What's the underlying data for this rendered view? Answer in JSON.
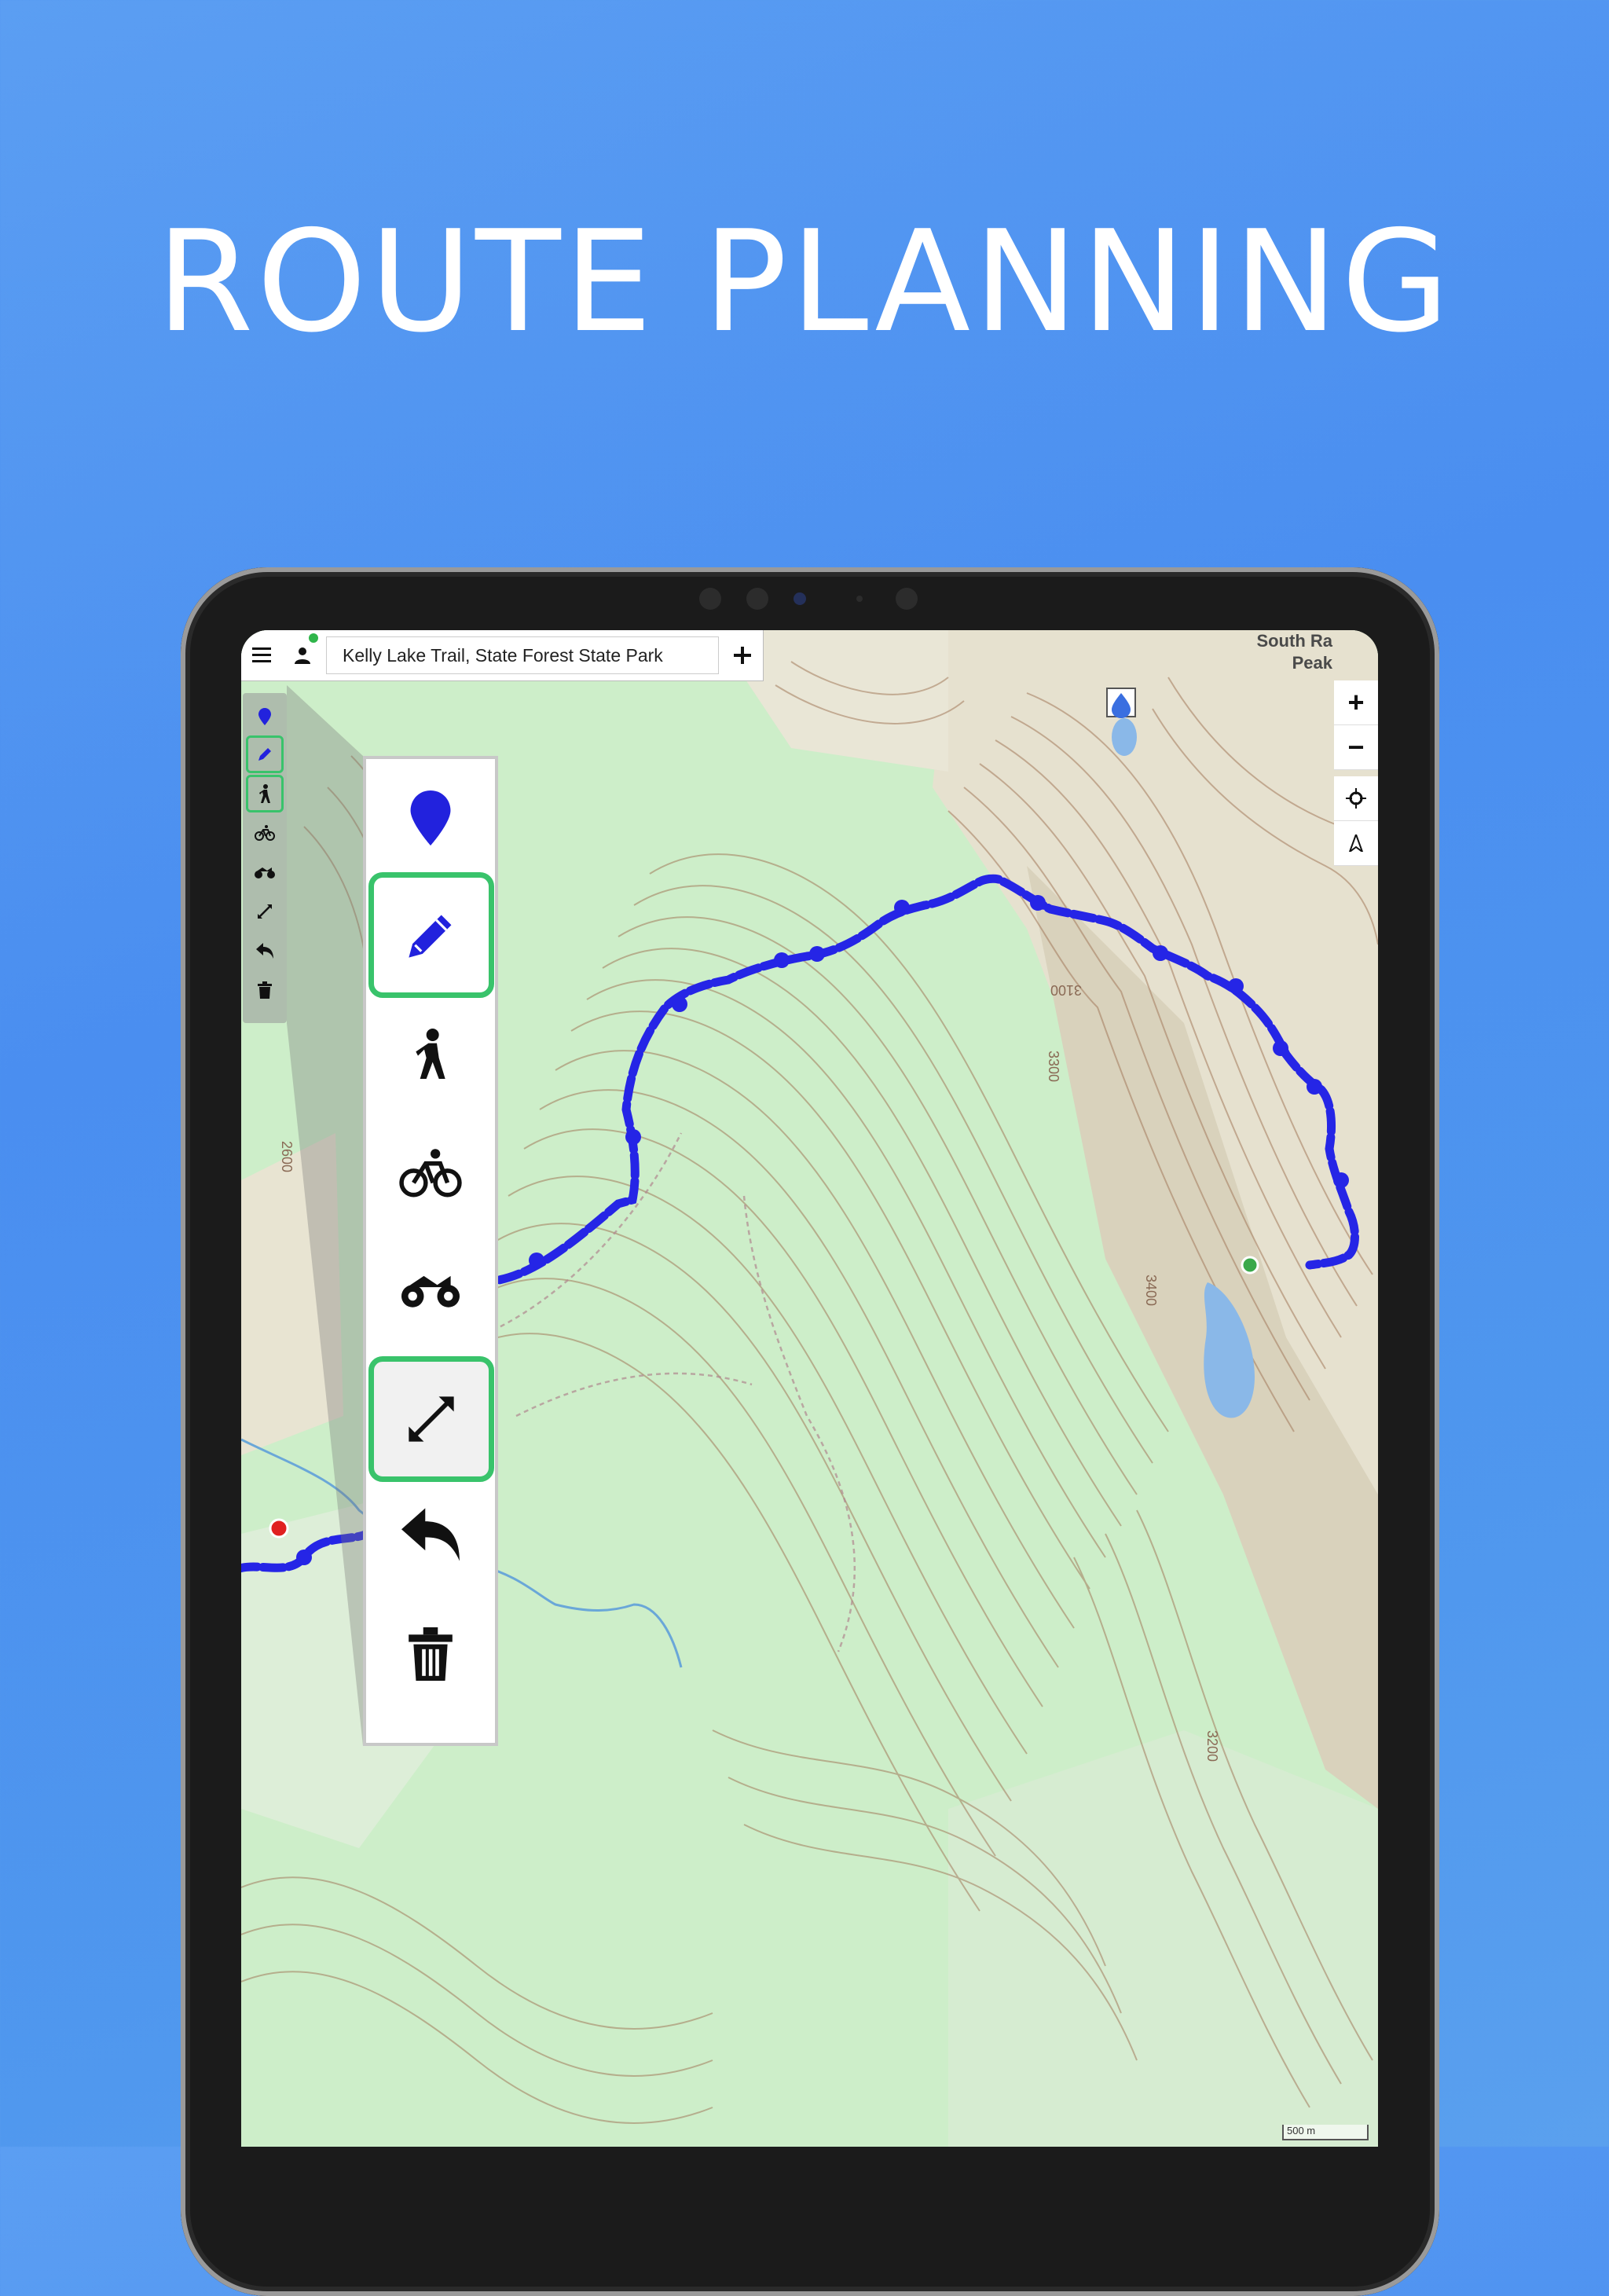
{
  "headline": "ROUTE PLANNING",
  "topbar": {
    "menu_icon": "hamburger-icon",
    "account_icon": "user-icon",
    "search_value": "Kelly Lake Trail, State Forest State Park",
    "add_icon": "plus-icon"
  },
  "map": {
    "peak_label_line1": "South Ra",
    "peak_label_line2": "Peak",
    "contour_labels": [
      "2600",
      "3100",
      "3300",
      "3400",
      "3200"
    ],
    "scale_label": "500 m"
  },
  "right_controls": [
    "+",
    "−"
  ],
  "mini_toolbar": {
    "items": [
      {
        "icon": "marker-icon",
        "active": false
      },
      {
        "icon": "pencil-icon",
        "active": true
      },
      {
        "icon": "hiker-icon",
        "active": true
      },
      {
        "icon": "bicycle-icon",
        "active": false
      },
      {
        "icon": "atv-icon",
        "active": false
      },
      {
        "icon": "straight-line-icon",
        "active": false
      },
      {
        "icon": "undo-icon",
        "active": false
      },
      {
        "icon": "trash-icon",
        "active": false
      }
    ]
  },
  "zoom_toolbar": {
    "items": [
      {
        "icon": "marker-icon",
        "active": false
      },
      {
        "icon": "pencil-icon",
        "active": true
      },
      {
        "icon": "hiker-icon",
        "active": false
      },
      {
        "icon": "bicycle-icon",
        "active": false
      },
      {
        "icon": "atv-icon",
        "active": false
      },
      {
        "icon": "straight-line-icon",
        "active": true
      },
      {
        "icon": "undo-icon",
        "active": false
      },
      {
        "icon": "trash-icon",
        "active": false
      }
    ]
  },
  "colors": {
    "background": "#4a8ef0",
    "route": "#2525e6",
    "active_outline": "#39c36b",
    "start_point": "#e02020",
    "end_point": "#3aa84a",
    "map_green": "#cfeecc",
    "contour": "#a0785a"
  }
}
